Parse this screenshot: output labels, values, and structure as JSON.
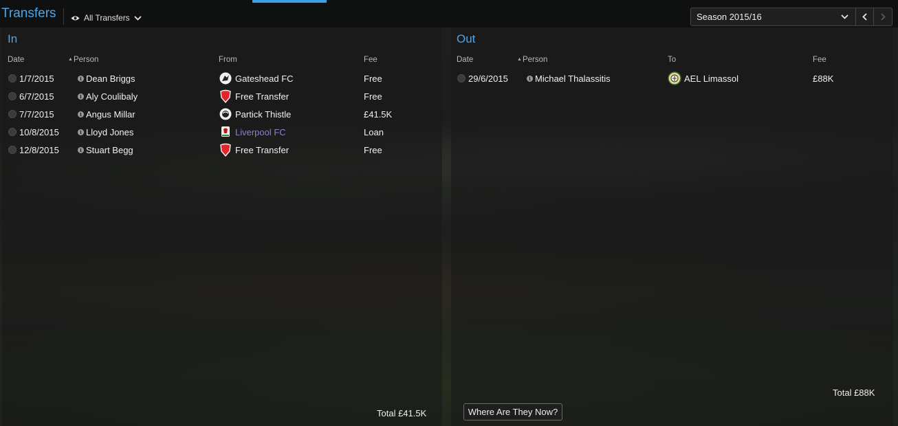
{
  "header": {
    "title": "Transfers",
    "filter_label": "All Transfers",
    "season_label": "Season 2015/16"
  },
  "in_panel": {
    "title": "In",
    "columns": {
      "date": "Date",
      "person": "Person",
      "from": "From",
      "fee": "Fee"
    },
    "rows": [
      {
        "date": "1/7/2015",
        "person": "Dean Briggs",
        "club": "Gateshead FC",
        "club_icon": "gateshead-crest-icon",
        "fee": "Free"
      },
      {
        "date": "6/7/2015",
        "person": "Aly Coulibaly",
        "club": "Free Transfer",
        "club_icon": "red-shield-icon",
        "fee": "Free"
      },
      {
        "date": "7/7/2015",
        "person": "Angus Millar",
        "club": "Partick Thistle",
        "club_icon": "partick-thistle-crest-icon",
        "fee": "£41.5K"
      },
      {
        "date": "10/8/2015",
        "person": "Lloyd Jones",
        "club": "Liverpool FC",
        "club_icon": "liverpool-crest-icon",
        "fee": "Loan"
      },
      {
        "date": "12/8/2015",
        "person": "Stuart Begg",
        "club": "Free Transfer",
        "club_icon": "red-shield-icon",
        "fee": "Free"
      }
    ],
    "total": "Total £41.5K"
  },
  "out_panel": {
    "title": "Out",
    "columns": {
      "date": "Date",
      "person": "Person",
      "to": "To",
      "fee": "Fee"
    },
    "rows": [
      {
        "date": "29/6/2015",
        "person": "Michael Thalassitis",
        "club": "AEL Limassol",
        "club_icon": "ael-limassol-crest-icon",
        "fee": "£88K"
      }
    ],
    "total": "Total £88K"
  },
  "footer": {
    "where_button": "Where Are They Now?"
  },
  "colors": {
    "accent": "#4aa8ee",
    "link": "#8b82c9",
    "shield_red": "#e0262b"
  }
}
